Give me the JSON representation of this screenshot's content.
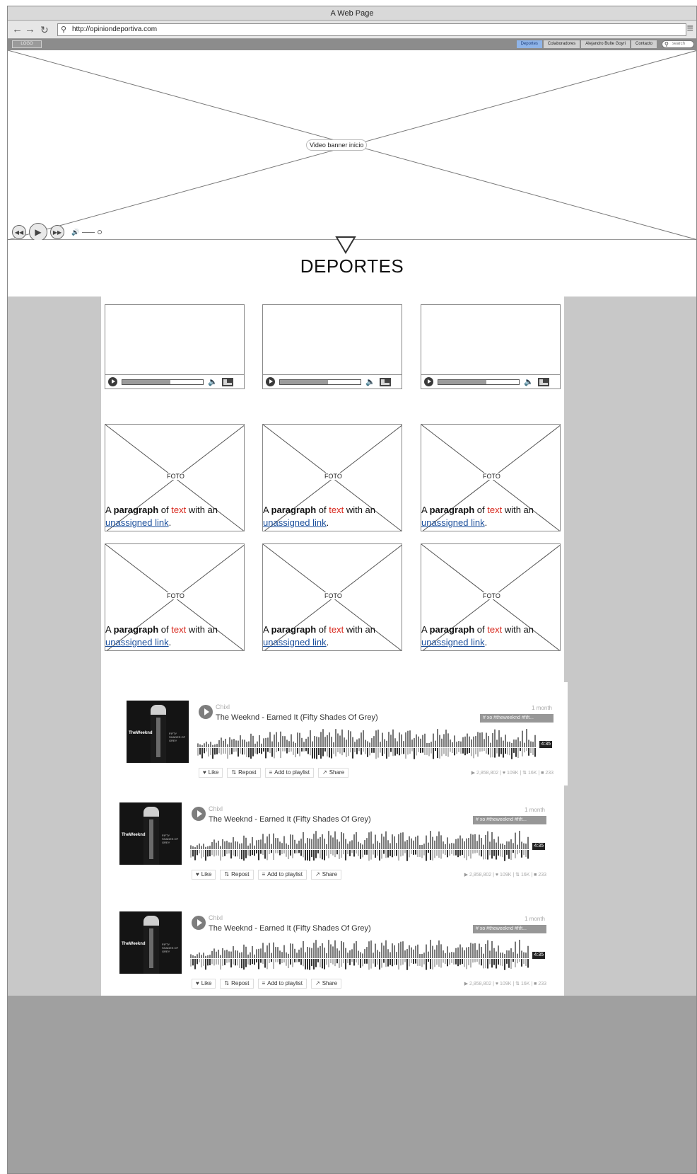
{
  "window": {
    "title": "A Web Page"
  },
  "address_bar": {
    "url": "http://opiniondeportiva.com"
  },
  "navbar": {
    "logo": "LOGO",
    "links": [
      {
        "label": "Deportes",
        "active": true
      },
      {
        "label": "Colaboradores",
        "active": false
      },
      {
        "label": "Alejandro Bulte Goyri",
        "active": false
      },
      {
        "label": "Contacto",
        "active": false
      }
    ],
    "search_placeholder": "search"
  },
  "banner": {
    "label": "Video banner inicio"
  },
  "section": {
    "title": "DEPORTES"
  },
  "videos": [
    {
      "progress": 0.6
    },
    {
      "progress": 0.6
    },
    {
      "progress": 0.6
    }
  ],
  "photo_cards": {
    "foto_label": "FOTO",
    "caption": {
      "prefix": "A ",
      "bold": "paragraph",
      "mid1": " of ",
      "red": "text",
      "mid2": " with an ",
      "link": "unassigned link",
      "end": "."
    },
    "count": 6
  },
  "soundcloud": {
    "user": "Chixl",
    "track": "The Weeknd - Earned It (Fifty Shades Of Grey)",
    "time_ago": "1 month",
    "tag": "# xo #theweeknd #fift...",
    "duration": "4:35",
    "buttons": {
      "like": "Like",
      "repost": "Repost",
      "playlist": "Add to playlist",
      "share": "Share"
    },
    "stats": {
      "plays": "2,858,802",
      "likes": "109K",
      "reposts": "16K",
      "comments": "233"
    },
    "art": {
      "title": "TheWeeknd",
      "subtitle": "FIFTY SHADES OF GREY"
    }
  },
  "colors": {
    "active_tab": "#8fb4e8",
    "caption_red": "#d8261b",
    "link_blue": "#1b4f9c"
  }
}
